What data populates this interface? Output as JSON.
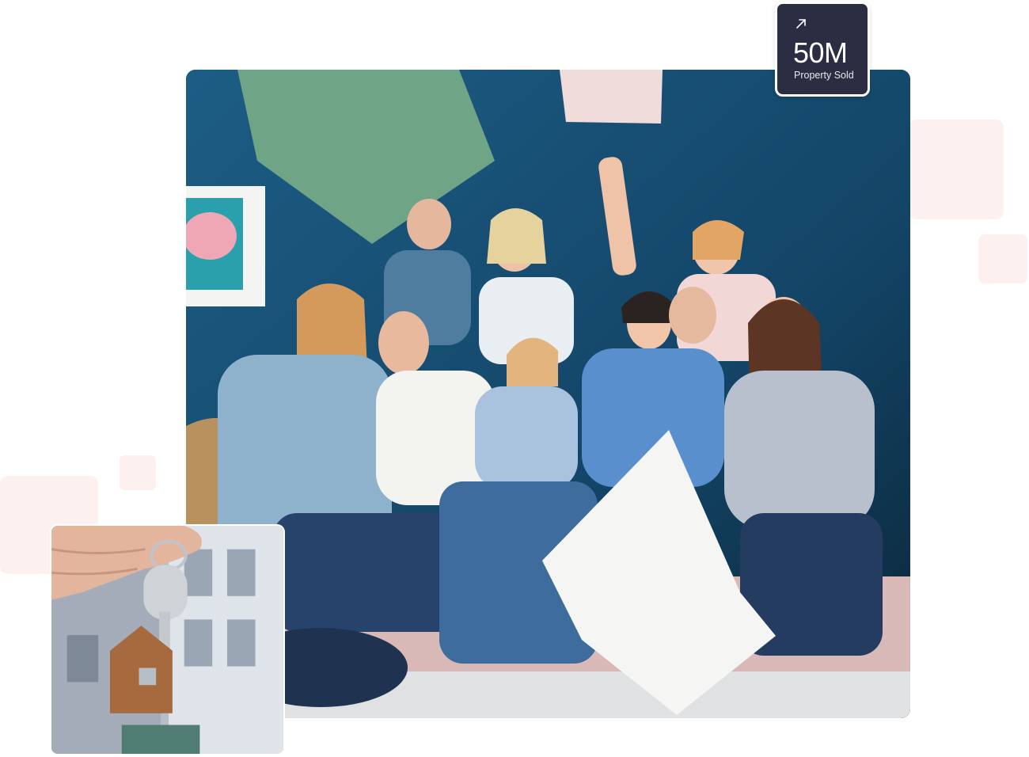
{
  "stat_badge": {
    "icon": "arrow-up-right-icon",
    "value": "50M",
    "label": "Property Sold"
  },
  "images": {
    "hero": "family-pillow-fight-photo",
    "secondary": "house-key-photo"
  },
  "colors": {
    "badge_background": "#2b2d42",
    "decor_blush": "#fdf1ef",
    "wall_blue": "#124a6e"
  }
}
